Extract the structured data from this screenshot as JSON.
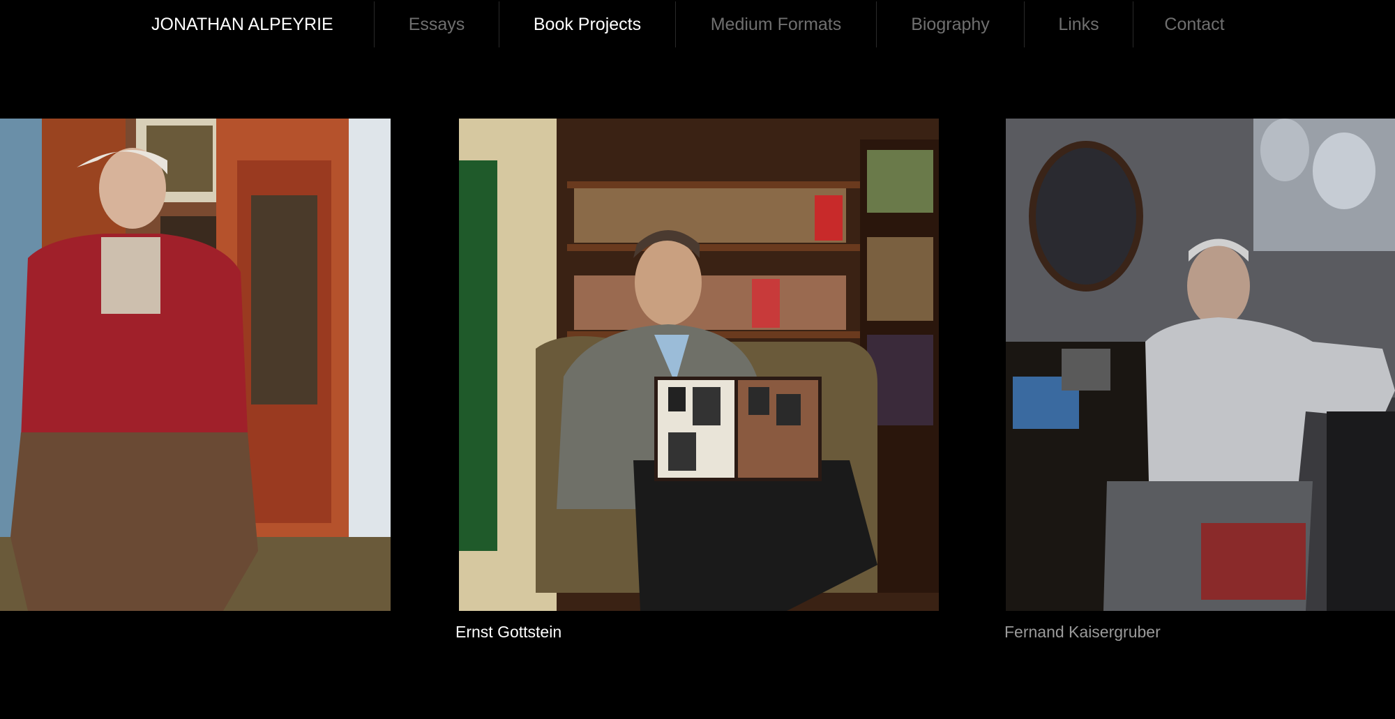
{
  "nav": {
    "brand": "JONATHAN ALPEYRIE",
    "items": [
      {
        "label": "Essays",
        "active": false
      },
      {
        "label": "Book Projects",
        "active": true
      },
      {
        "label": "Medium Formats",
        "active": false
      },
      {
        "label": "Biography",
        "active": false
      },
      {
        "label": "Links",
        "active": false
      },
      {
        "label": "Contact",
        "active": false
      }
    ]
  },
  "gallery": {
    "photos": [
      {
        "caption": "",
        "description": "portrait-elderly-man-red-cardigan"
      },
      {
        "caption": "Ernst Gottstein",
        "description": "portrait-man-armchair-bookshelf"
      },
      {
        "caption": "Fernand Kaisergruber",
        "description": "portrait-man-white-shirt"
      }
    ]
  },
  "colors": {
    "background": "#000000",
    "nav_active": "#ffffff",
    "nav_inactive": "#6f6f6f",
    "caption_dim": "#9a9a9a"
  }
}
